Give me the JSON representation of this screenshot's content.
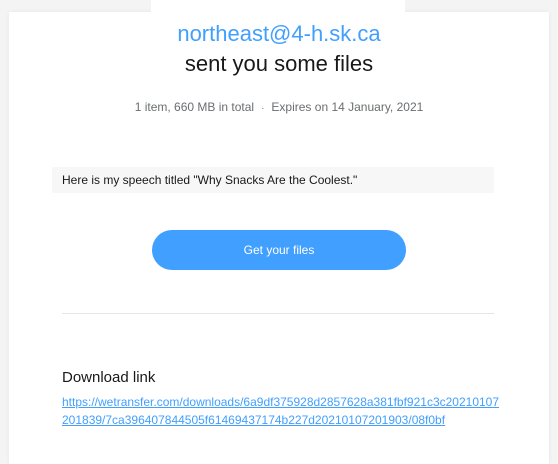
{
  "email": {
    "sender": "northeast@4-h.sk.ca",
    "subtitle": "sent you some files",
    "summary": "1 item, 660 MB in total",
    "separator": "·",
    "expires": "Expires on 14 January, 2021",
    "message": "Here is my speech titled \"Why Snacks Are the Coolest.\"",
    "button_label": "Get your files",
    "download_heading": "Download link",
    "download_url": "https://wetransfer.com/downloads/6a9df375928d2857628a381fbf921c3c20210107201839/7ca396407844505f61469437174b227d20210107201903/08f0bf"
  },
  "colors": {
    "accent": "#409fff",
    "text": "#17181a",
    "muted": "#6a6d70",
    "background": "#f4f4f4",
    "card": "#ffffff"
  }
}
